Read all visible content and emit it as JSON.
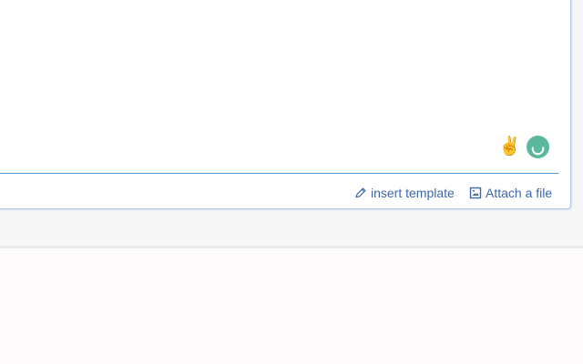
{
  "composer": {
    "actions": {
      "insert_template": "insert template",
      "attach_file": "Attach a file"
    },
    "icons": {
      "emoji": "✌️",
      "assistant": "loading-spinner-icon",
      "insert_template": "pencil-icon",
      "attach_file": "image-icon"
    }
  }
}
